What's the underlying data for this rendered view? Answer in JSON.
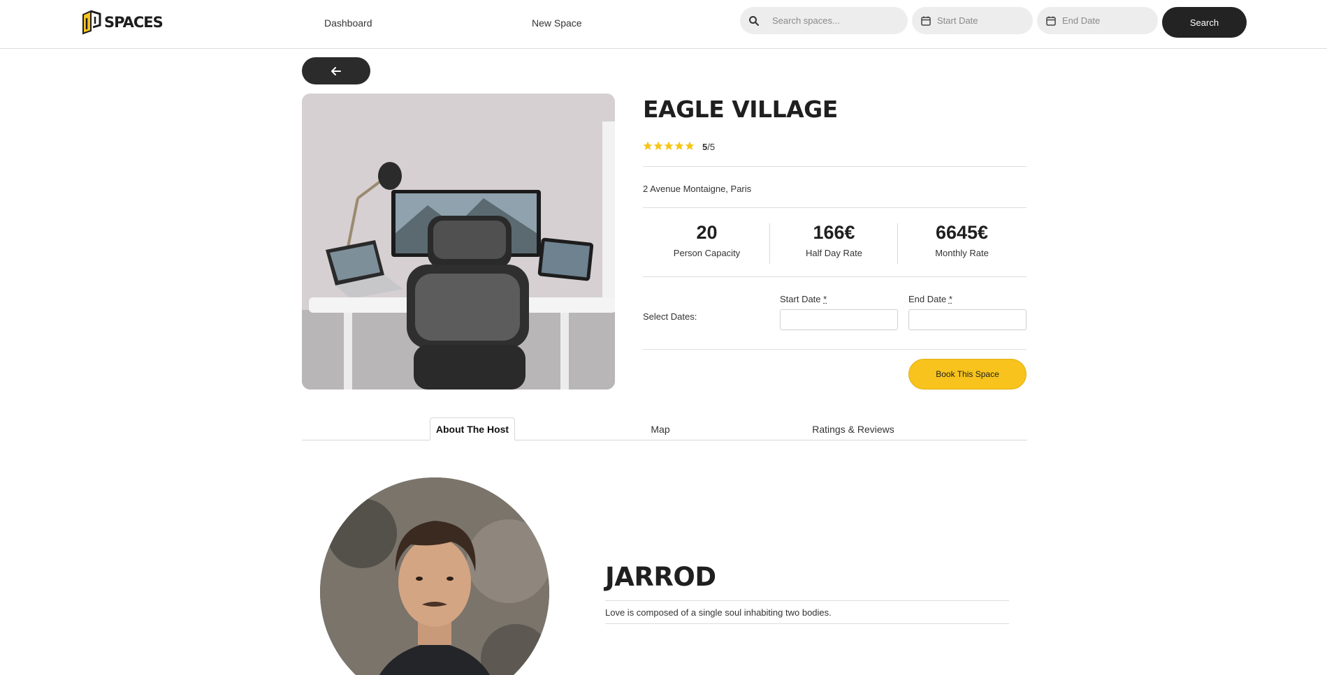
{
  "header": {
    "logo_text": "SPACES",
    "nav": {
      "dashboard": "Dashboard",
      "new_space": "New Space"
    },
    "search": {
      "placeholder": "Search spaces...",
      "start_placeholder": "Start Date",
      "end_placeholder": "End Date",
      "button_label": "Search"
    }
  },
  "space": {
    "title": "EAGLE VILLAGE",
    "rating_value": "5",
    "rating_max": "/5",
    "stars": 5,
    "address": "2 Avenue Montaigne, Paris",
    "stats": [
      {
        "value": "20",
        "label": "Person Capacity"
      },
      {
        "value": "166€",
        "label": "Half Day Rate"
      },
      {
        "value": "6645€",
        "label": "Monthly Rate"
      }
    ],
    "booking": {
      "select_label": "Select Dates:",
      "start_label": "Start Date",
      "end_label": "End Date",
      "required_mark": "*",
      "book_label": "Book This Space"
    }
  },
  "tabs": [
    {
      "label": "About The Host",
      "active": true
    },
    {
      "label": "Map",
      "active": false
    },
    {
      "label": "Ratings & Reviews",
      "active": false
    }
  ],
  "host": {
    "name": "JARROD",
    "quote": "Love is composed of a single soul inhabiting two bodies."
  },
  "colors": {
    "accent": "#f7c31c",
    "dark": "#232323",
    "star": "#f5c518"
  }
}
